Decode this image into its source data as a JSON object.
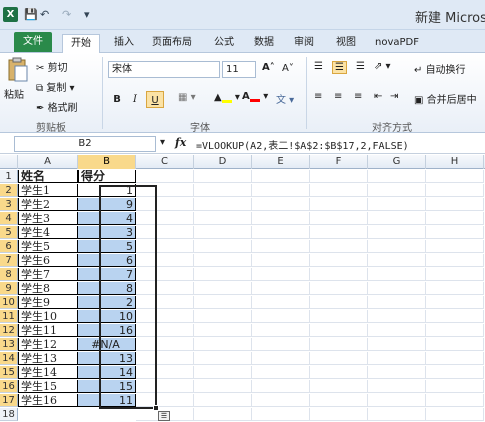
{
  "titlebar": {
    "app_icon": "X",
    "title": "新建 Micros",
    "quick_access": [
      "save-icon",
      "undo-icon",
      "redo-icon",
      "customize-icon"
    ]
  },
  "tabs": [
    "文件",
    "开始",
    "插入",
    "页面布局",
    "公式",
    "数据",
    "审阅",
    "视图",
    "novaPDF"
  ],
  "ribbon": {
    "clipboard": {
      "paste": "粘贴",
      "cut": "剪切",
      "copy": "复制",
      "format_painter": "格式刷",
      "label": "剪贴板"
    },
    "font": {
      "name": "宋体",
      "size": "11",
      "bold": "B",
      "italic": "I",
      "underline": "U",
      "label": "字体"
    },
    "alignment": {
      "wrap": "自动换行",
      "merge": "合并后居中",
      "label": "对齐方式"
    }
  },
  "formula_bar": {
    "name_box": "B2",
    "fx": "fx",
    "formula": "=VLOOKUP(A2,表二!$A$2:$B$17,2,FALSE)"
  },
  "columns": [
    "A",
    "B",
    "C",
    "D",
    "E",
    "F",
    "G",
    "H"
  ],
  "rows": [
    {
      "n": "1",
      "a": "姓名",
      "b": "得分"
    },
    {
      "n": "2",
      "a": "学生1",
      "b": "1"
    },
    {
      "n": "3",
      "a": "学生2",
      "b": "9"
    },
    {
      "n": "4",
      "a": "学生3",
      "b": "4"
    },
    {
      "n": "5",
      "a": "学生4",
      "b": "3"
    },
    {
      "n": "6",
      "a": "学生5",
      "b": "5"
    },
    {
      "n": "7",
      "a": "学生6",
      "b": "6"
    },
    {
      "n": "8",
      "a": "学生7",
      "b": "7"
    },
    {
      "n": "9",
      "a": "学生8",
      "b": "8"
    },
    {
      "n": "10",
      "a": "学生9",
      "b": "2"
    },
    {
      "n": "11",
      "a": "学生10",
      "b": "10"
    },
    {
      "n": "12",
      "a": "学生11",
      "b": "16"
    },
    {
      "n": "13",
      "a": "学生12",
      "b": "#N/A"
    },
    {
      "n": "14",
      "a": "学生13",
      "b": "13"
    },
    {
      "n": "15",
      "a": "学生14",
      "b": "14"
    },
    {
      "n": "16",
      "a": "学生15",
      "b": "15"
    },
    {
      "n": "17",
      "a": "学生16",
      "b": "11"
    },
    {
      "n": "18",
      "a": "",
      "b": ""
    }
  ]
}
